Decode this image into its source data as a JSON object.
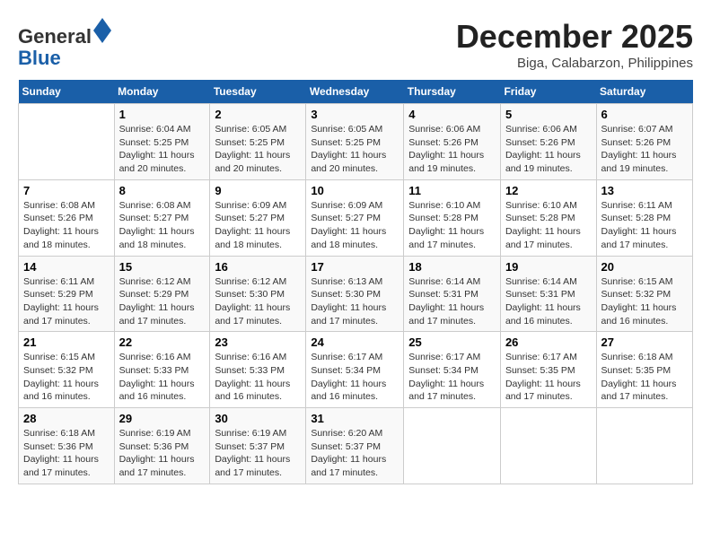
{
  "header": {
    "logo_general": "General",
    "logo_blue": "Blue",
    "month_title": "December 2025",
    "location": "Biga, Calabarzon, Philippines"
  },
  "weekdays": [
    "Sunday",
    "Monday",
    "Tuesday",
    "Wednesday",
    "Thursday",
    "Friday",
    "Saturday"
  ],
  "weeks": [
    [
      {
        "day": "",
        "info": ""
      },
      {
        "day": "1",
        "info": "Sunrise: 6:04 AM\nSunset: 5:25 PM\nDaylight: 11 hours and 20 minutes."
      },
      {
        "day": "2",
        "info": "Sunrise: 6:05 AM\nSunset: 5:25 PM\nDaylight: 11 hours and 20 minutes."
      },
      {
        "day": "3",
        "info": "Sunrise: 6:05 AM\nSunset: 5:25 PM\nDaylight: 11 hours and 20 minutes."
      },
      {
        "day": "4",
        "info": "Sunrise: 6:06 AM\nSunset: 5:26 PM\nDaylight: 11 hours and 19 minutes."
      },
      {
        "day": "5",
        "info": "Sunrise: 6:06 AM\nSunset: 5:26 PM\nDaylight: 11 hours and 19 minutes."
      },
      {
        "day": "6",
        "info": "Sunrise: 6:07 AM\nSunset: 5:26 PM\nDaylight: 11 hours and 19 minutes."
      }
    ],
    [
      {
        "day": "7",
        "info": "Sunrise: 6:08 AM\nSunset: 5:26 PM\nDaylight: 11 hours and 18 minutes."
      },
      {
        "day": "8",
        "info": "Sunrise: 6:08 AM\nSunset: 5:27 PM\nDaylight: 11 hours and 18 minutes."
      },
      {
        "day": "9",
        "info": "Sunrise: 6:09 AM\nSunset: 5:27 PM\nDaylight: 11 hours and 18 minutes."
      },
      {
        "day": "10",
        "info": "Sunrise: 6:09 AM\nSunset: 5:27 PM\nDaylight: 11 hours and 18 minutes."
      },
      {
        "day": "11",
        "info": "Sunrise: 6:10 AM\nSunset: 5:28 PM\nDaylight: 11 hours and 17 minutes."
      },
      {
        "day": "12",
        "info": "Sunrise: 6:10 AM\nSunset: 5:28 PM\nDaylight: 11 hours and 17 minutes."
      },
      {
        "day": "13",
        "info": "Sunrise: 6:11 AM\nSunset: 5:28 PM\nDaylight: 11 hours and 17 minutes."
      }
    ],
    [
      {
        "day": "14",
        "info": "Sunrise: 6:11 AM\nSunset: 5:29 PM\nDaylight: 11 hours and 17 minutes."
      },
      {
        "day": "15",
        "info": "Sunrise: 6:12 AM\nSunset: 5:29 PM\nDaylight: 11 hours and 17 minutes."
      },
      {
        "day": "16",
        "info": "Sunrise: 6:12 AM\nSunset: 5:30 PM\nDaylight: 11 hours and 17 minutes."
      },
      {
        "day": "17",
        "info": "Sunrise: 6:13 AM\nSunset: 5:30 PM\nDaylight: 11 hours and 17 minutes."
      },
      {
        "day": "18",
        "info": "Sunrise: 6:14 AM\nSunset: 5:31 PM\nDaylight: 11 hours and 17 minutes."
      },
      {
        "day": "19",
        "info": "Sunrise: 6:14 AM\nSunset: 5:31 PM\nDaylight: 11 hours and 16 minutes."
      },
      {
        "day": "20",
        "info": "Sunrise: 6:15 AM\nSunset: 5:32 PM\nDaylight: 11 hours and 16 minutes."
      }
    ],
    [
      {
        "day": "21",
        "info": "Sunrise: 6:15 AM\nSunset: 5:32 PM\nDaylight: 11 hours and 16 minutes."
      },
      {
        "day": "22",
        "info": "Sunrise: 6:16 AM\nSunset: 5:33 PM\nDaylight: 11 hours and 16 minutes."
      },
      {
        "day": "23",
        "info": "Sunrise: 6:16 AM\nSunset: 5:33 PM\nDaylight: 11 hours and 16 minutes."
      },
      {
        "day": "24",
        "info": "Sunrise: 6:17 AM\nSunset: 5:34 PM\nDaylight: 11 hours and 16 minutes."
      },
      {
        "day": "25",
        "info": "Sunrise: 6:17 AM\nSunset: 5:34 PM\nDaylight: 11 hours and 17 minutes."
      },
      {
        "day": "26",
        "info": "Sunrise: 6:17 AM\nSunset: 5:35 PM\nDaylight: 11 hours and 17 minutes."
      },
      {
        "day": "27",
        "info": "Sunrise: 6:18 AM\nSunset: 5:35 PM\nDaylight: 11 hours and 17 minutes."
      }
    ],
    [
      {
        "day": "28",
        "info": "Sunrise: 6:18 AM\nSunset: 5:36 PM\nDaylight: 11 hours and 17 minutes."
      },
      {
        "day": "29",
        "info": "Sunrise: 6:19 AM\nSunset: 5:36 PM\nDaylight: 11 hours and 17 minutes."
      },
      {
        "day": "30",
        "info": "Sunrise: 6:19 AM\nSunset: 5:37 PM\nDaylight: 11 hours and 17 minutes."
      },
      {
        "day": "31",
        "info": "Sunrise: 6:20 AM\nSunset: 5:37 PM\nDaylight: 11 hours and 17 minutes."
      },
      {
        "day": "",
        "info": ""
      },
      {
        "day": "",
        "info": ""
      },
      {
        "day": "",
        "info": ""
      }
    ]
  ]
}
